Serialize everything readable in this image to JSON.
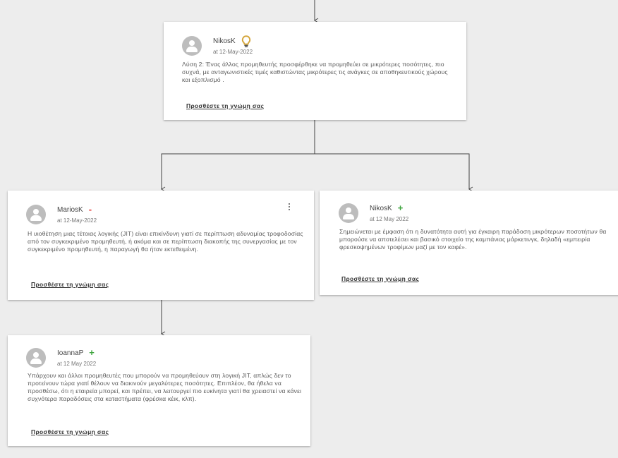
{
  "colors": {
    "background": "#ededed",
    "card": "#ffffff",
    "plus": "#3fa53f",
    "minus": "#e53935",
    "bulb": "#d4a53a",
    "connector": "#444444"
  },
  "cards": [
    {
      "id": "solution-2",
      "author": "NikosK",
      "date": "at 12-May-2022",
      "badge": "idea",
      "badge_icon": "lightbulb-icon",
      "text": "Λύση 2: Ένας άλλος προμηθευτής προσφέρθηκε να προμηθεύει σε μικρότερες ποσότητες, πιο συχνά, με ανταγωνιστικές τιμές καθιστώντας μικρότερες τις ανάγκες σε αποθηκευτικούς χώρους και εξοπλισμό .",
      "link": "Προσθέστε τη γνώμη σας"
    },
    {
      "id": "opinion-marios",
      "author": "MariosK",
      "date": "at 12-May-2022",
      "badge": "-",
      "badge_icon": "minus-icon",
      "text": "Η υιοθέτηση μιας τέτοιας λογικής (JIT) είναι επικίνδυνη γιατί σε περίπτωση αδυναμίας τροφοδοσίας από τον συγκεκριμένο προμηθευτή, ή ακόμα και σε περίπτωση διακοπής της συνεργασίας με τον συγκεκριμένο προμηθευτή, η παραγωγή θα ήταν εκτεθειμένη.",
      "link": "Προσθέστε τη γνώμη σας"
    },
    {
      "id": "opinion-nikos",
      "author": "NikosK",
      "date": "at 12 May 2022",
      "badge": "+",
      "badge_icon": "plus-icon",
      "text": "Σημειώνεται με έμφαση ότι η δυνατότητα αυτή για έγκαιρη παράδοση μικρότερων ποσοτήτων θα μπορούσε να αποτελέσει και βασικό στοιχείο της καμπάνιας μάρκετινγκ, δηλαδή «εμπειρία φρεσκοψημένων τροφίμων μαζί με τον καφέ».",
      "link": "Προσθέστε τη γνώμη σας"
    },
    {
      "id": "opinion-ioanna",
      "author": "IoannaP",
      "date": "at 12 May 2022",
      "badge": "+",
      "badge_icon": "plus-icon",
      "text": "Υπάρχουν και άλλοι προμηθευτές που μπορούν να προμηθεύουν στη λογική JIT, απλώς δεν το προτείνουν τώρα γιατί θέλουν να διακινούν μεγαλύτερες ποσότητες. Επιπλέον, θα ήθελα να προσθέσω, ότι η εταιρεία μπορεί, και πρέπει, να λειτουργεί πιο ευκίνητα γιατί θα χρειαστεί να κάνει συχνότερα παραδόσεις στα καταστήματα (φρέσκα κέικ, κλπ).",
      "link": "Προσθέστε τη γνώμη σας"
    }
  ]
}
